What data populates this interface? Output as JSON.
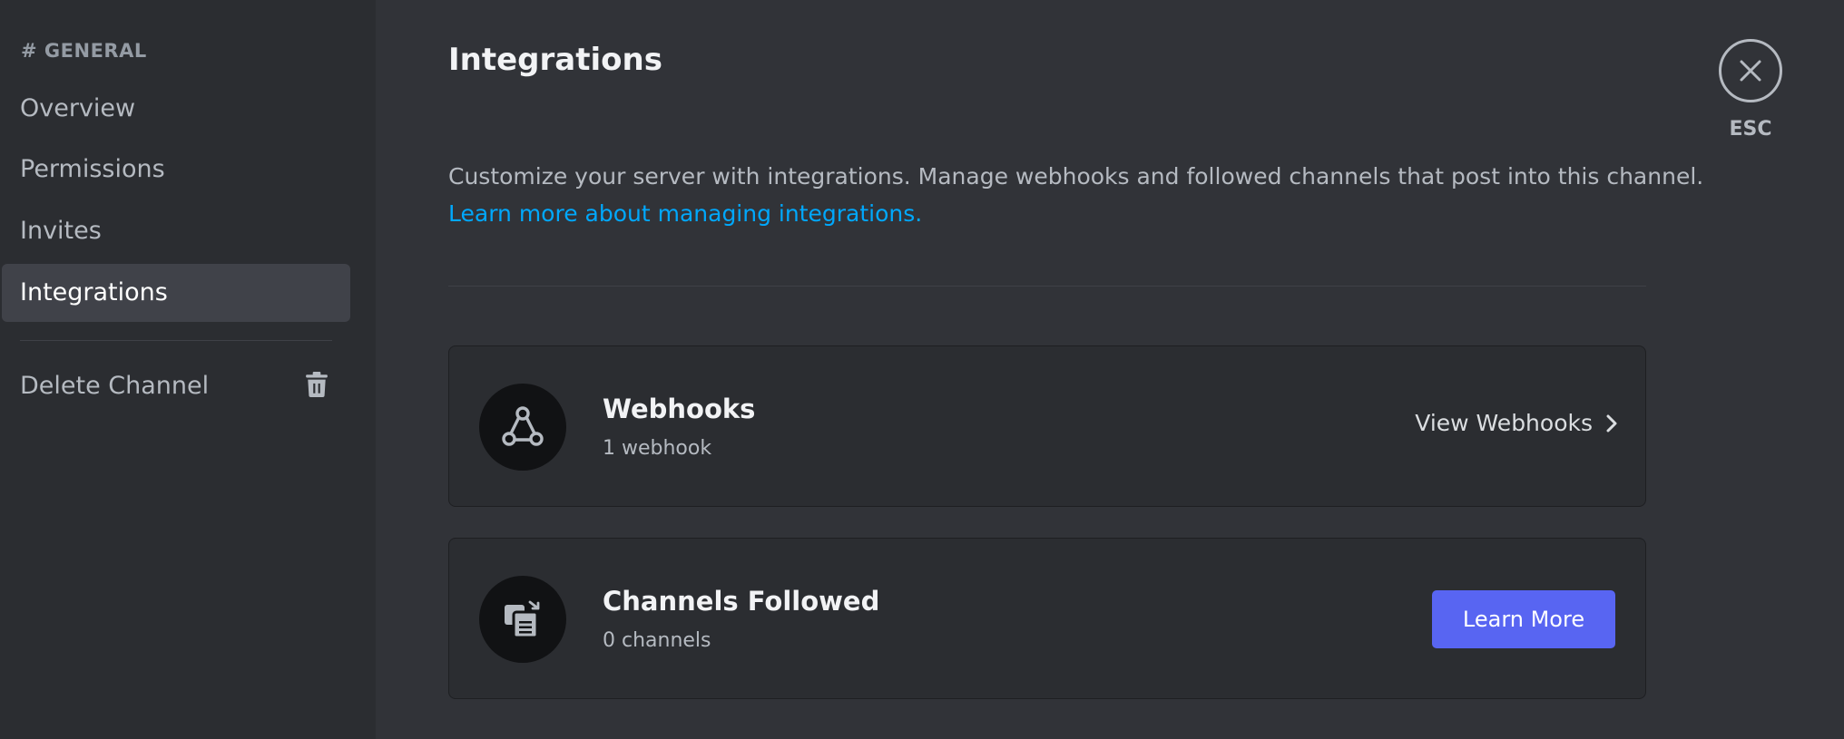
{
  "sidebar": {
    "header": "# GENERAL",
    "items": [
      {
        "label": "Overview"
      },
      {
        "label": "Permissions"
      },
      {
        "label": "Invites"
      },
      {
        "label": "Integrations",
        "selected": true
      }
    ],
    "delete_label": "Delete Channel",
    "delete_icon": "trash-icon"
  },
  "main": {
    "title": "Integrations",
    "description": "Customize your server with integrations. Manage webhooks and followed channels that post into this channel.",
    "learn_link": "Learn more about managing integrations.",
    "cards": [
      {
        "icon": "webhook-icon",
        "title": "Webhooks",
        "subtitle": "1 webhook",
        "action": "View Webhooks",
        "action_icon": "chevron-right-icon"
      },
      {
        "icon": "channels-followed-icon",
        "title": "Channels Followed",
        "subtitle": "0 channels",
        "action": "Learn More"
      }
    ]
  },
  "close": {
    "icon": "close-icon",
    "label": "ESC"
  },
  "colors": {
    "background": "#313338",
    "sidebar": "#2b2d31",
    "selected": "#404249",
    "accent": "#5865f2",
    "link": "#00a8fc"
  }
}
